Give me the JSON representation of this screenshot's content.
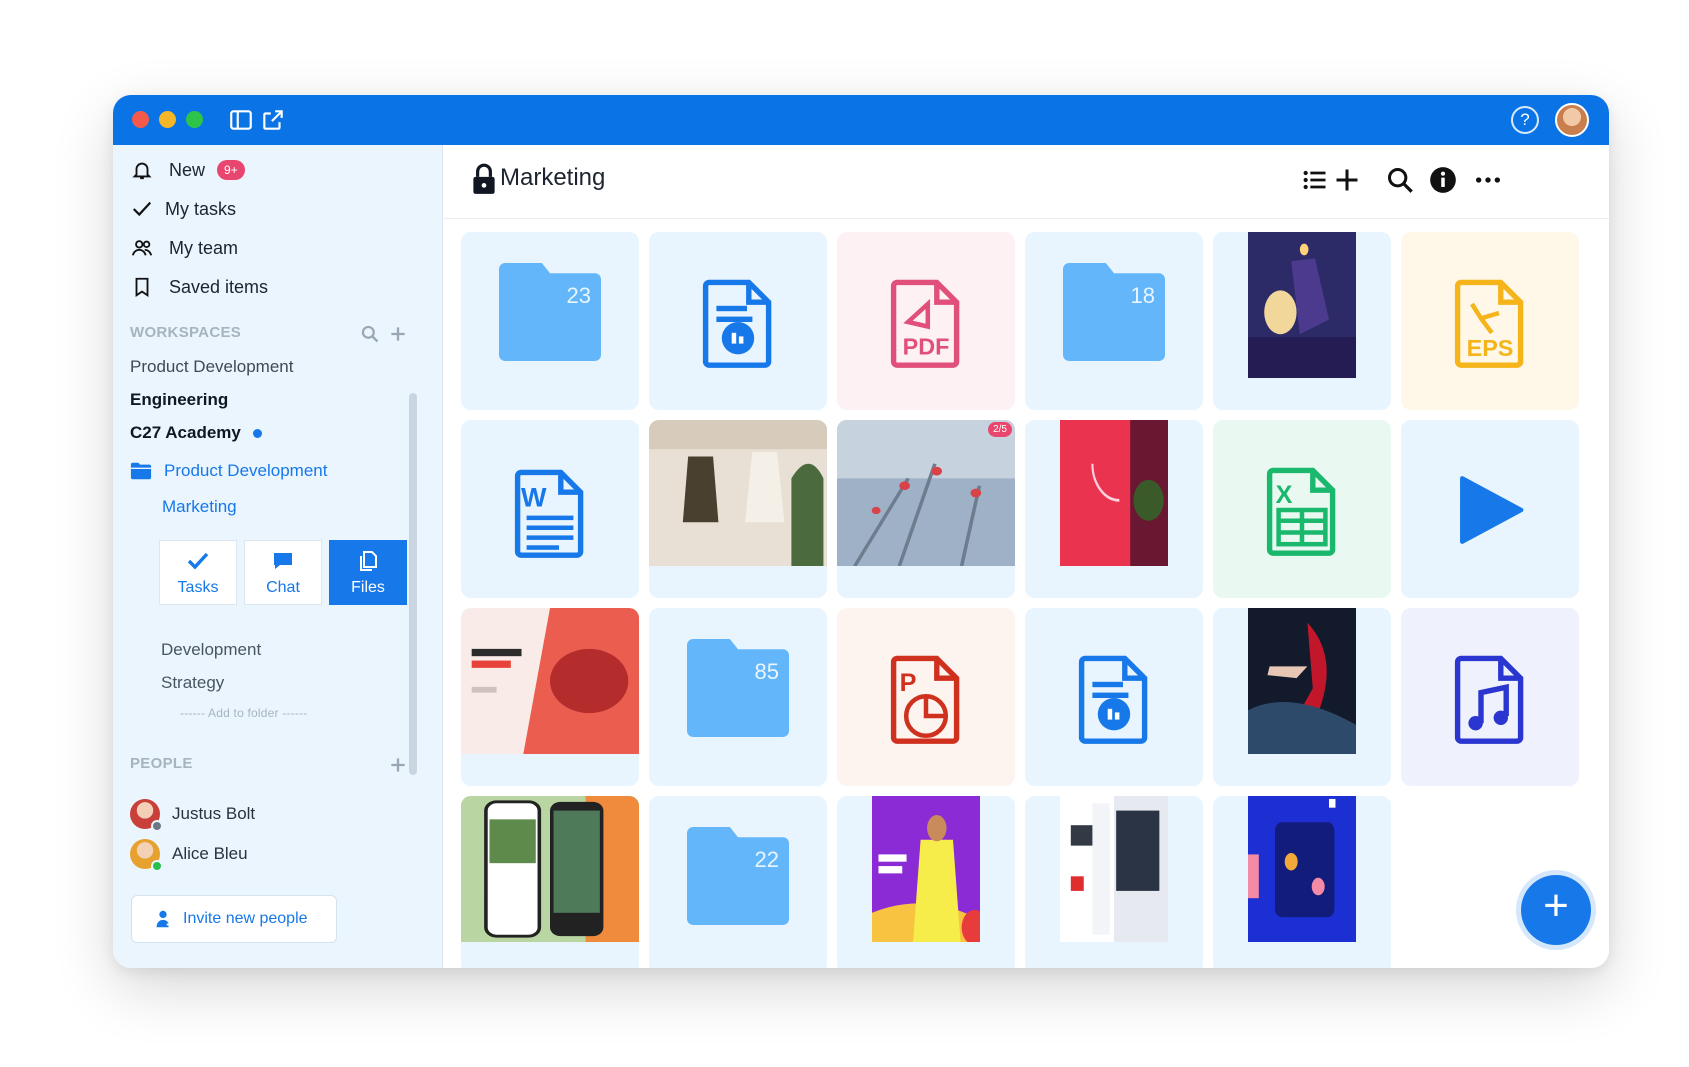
{
  "titlebar": {
    "help_icon": "question-circle-icon",
    "avatar": "user-avatar"
  },
  "sidebar": {
    "nav": [
      {
        "label": "New",
        "icon": "bell-icon",
        "badge": "9+"
      },
      {
        "label": "My tasks",
        "icon": "checkmark-icon"
      },
      {
        "label": "My team",
        "icon": "team-icon"
      },
      {
        "label": "Saved items",
        "icon": "bookmark-icon"
      }
    ],
    "workspaces_title": "WORKSPACES",
    "workspaces": [
      {
        "label": "Product Development"
      },
      {
        "label": "Engineering"
      },
      {
        "label": "C27 Academy"
      }
    ],
    "active_folder": "Product Development",
    "active_subfolder": "Marketing",
    "segments": [
      {
        "label": "Tasks",
        "icon": "check-icon"
      },
      {
        "label": "Chat",
        "icon": "chat-bubble-icon"
      },
      {
        "label": "Files",
        "icon": "files-icon"
      }
    ],
    "subfolders": [
      "Development",
      "Strategy"
    ],
    "add_to_folder": "------ Add to folder ------",
    "people_title": "PEOPLE",
    "people": [
      {
        "name": "Justus Bolt",
        "status_color": "#6c7884"
      },
      {
        "name": "Alice Bleu",
        "status_color": "#27c04a"
      }
    ],
    "invite_label": "Invite new people"
  },
  "main": {
    "title": "Marketing",
    "tiles": [
      {
        "kind": "folder",
        "count": "23",
        "bg": "#e8f4fe"
      },
      {
        "kind": "chat-doc",
        "bg": "#e8f4fe"
      },
      {
        "kind": "pdf",
        "bg": "#fdf1f4"
      },
      {
        "kind": "folder",
        "count": "18",
        "bg": "#e8f4fe"
      },
      {
        "kind": "image",
        "name": "night-scene",
        "bg": "#e8f4fe"
      },
      {
        "kind": "eps",
        "bg": "#fff8e8"
      },
      {
        "kind": "word",
        "bg": "#e8f4fe"
      },
      {
        "kind": "image",
        "name": "fashion-models",
        "bg": "#e8f4fe"
      },
      {
        "kind": "image",
        "name": "winter-berries",
        "count_badge": "2/5",
        "bg": "#e8f4fe"
      },
      {
        "kind": "image",
        "name": "neon-room",
        "bg": "#e8f4fe"
      },
      {
        "kind": "excel",
        "bg": "#e9f9f1"
      },
      {
        "kind": "video",
        "bg": "#e8f4fe"
      },
      {
        "kind": "image",
        "name": "defining-the-new-art",
        "bg": "#e8f4fe"
      },
      {
        "kind": "folder",
        "count": "85",
        "bg": "#e8f4fe"
      },
      {
        "kind": "powerpoint",
        "bg": "#fdf3ef"
      },
      {
        "kind": "chat-doc",
        "bg": "#e8f4fe"
      },
      {
        "kind": "image",
        "name": "dancer-red-dress",
        "bg": "#e8f4fe"
      },
      {
        "kind": "audio",
        "bg": "#eff2fd"
      },
      {
        "kind": "image",
        "name": "travel-app",
        "bg": "#e8f4fe"
      },
      {
        "kind": "folder",
        "count": "22",
        "bg": "#e8f4fe"
      },
      {
        "kind": "image",
        "name": "summer-collection",
        "bg": "#e8f4fe"
      },
      {
        "kind": "image",
        "name": "web-layout",
        "bg": "#e8f4fe"
      },
      {
        "kind": "image",
        "name": "gather-round-poster",
        "bg": "#e8f4fe"
      }
    ]
  }
}
